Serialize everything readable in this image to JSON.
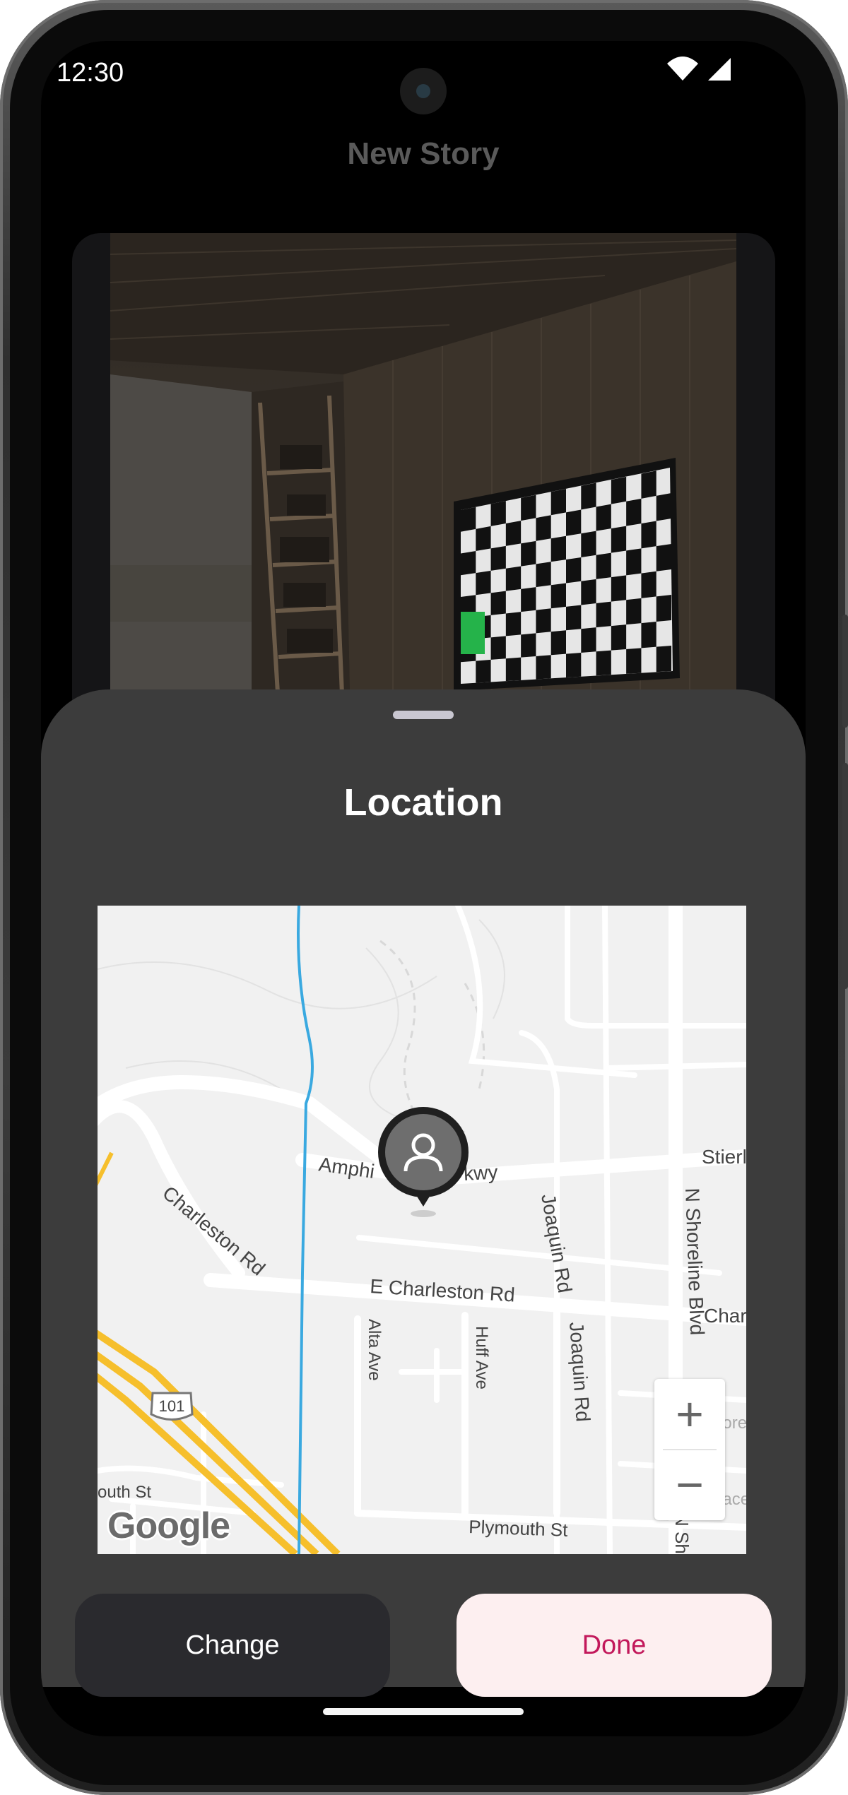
{
  "status_bar": {
    "time": "12:30"
  },
  "header": {
    "title": "New Story"
  },
  "sheet": {
    "title": "Location",
    "map": {
      "streets": {
        "amphitheatre_left": "Amphi",
        "amphitheatre_right": "Pkwy",
        "stierlin": "Stierl",
        "charleston_rd": "Charleston Rd",
        "e_charleston_rd": "E Charleston Rd",
        "charl": "Charl",
        "joaquin_rd_top": "Joaquin Rd",
        "joaquin_rd_bottom": "Joaquin Rd",
        "n_shoreline_blvd": "N Shoreline Blvd",
        "alta_ave": "Alta Ave",
        "huff_ave": "Huff Ave",
        "shore": "Shore",
        "space": "Space",
        "south_st": "outh St",
        "plymouth_st": "Plymouth St",
        "n_sh": "N Sh",
        "route": "101"
      },
      "zoom_in_label": "+",
      "zoom_out_label": "−",
      "attribution": "Google",
      "pin_icon": "person-pin-icon"
    },
    "buttons": {
      "change_label": "Change",
      "done_label": "Done"
    }
  },
  "colors": {
    "sheet_bg": "#3c3c3c",
    "done_text": "#c2185b",
    "done_bg": "#fdeff0",
    "change_bg": "#2a2a2e",
    "highway": "#f6bf2c",
    "creek": "#3aa9e0"
  }
}
